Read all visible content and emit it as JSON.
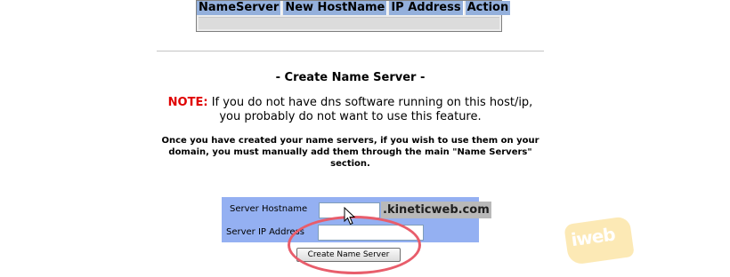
{
  "nameserver_table": {
    "columns": [
      "NameServer",
      "New HostName",
      "IP Address",
      "Action"
    ]
  },
  "section_title": "- Create Name Server -",
  "note": {
    "label": "NOTE:",
    "line1": " If you do not have dns software running on this host/ip,",
    "line2": "you probably do not want to use this feature."
  },
  "info": {
    "line1": "Once you have created your name servers, if you wish to use them on your",
    "line2": "domain, you must manually add them through the main \"Name Servers\"",
    "line3": "section."
  },
  "form": {
    "hostname_label": "Server Hostname",
    "hostname_value": "",
    "domain_suffix": ".kineticweb.com",
    "ip_label": "Server IP Address",
    "ip_value": "",
    "submit_label": "Create Name Server"
  },
  "watermark": {
    "text": "iweb"
  },
  "colors": {
    "table_header": "#94b0dc",
    "form_panel": "#94b0f2",
    "note_red": "#e00000",
    "highlight": "#e85d6b"
  }
}
